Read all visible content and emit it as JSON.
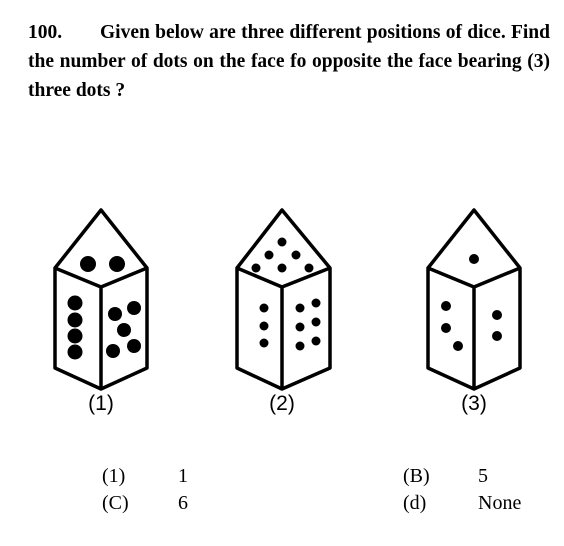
{
  "question": {
    "number": "100.",
    "text": "Given below are three different positions of dice. Find the number of  dots on the face fo opposite the face bearing  (3) three dots ?"
  },
  "dice": [
    {
      "label": "(1)",
      "top_face_dots": 2,
      "left_face_dots": 4,
      "right_face_dots": 5
    },
    {
      "label": "(2)",
      "top_face_dots": 6,
      "left_face_dots": 3,
      "right_face_dots": 6
    },
    {
      "label": "(3)",
      "top_face_dots": 1,
      "left_face_dots": 3,
      "right_face_dots": 2
    }
  ],
  "options": [
    {
      "key": "(1)",
      "value": "1"
    },
    {
      "key": "(B)",
      "value": "5"
    },
    {
      "key": "(C)",
      "value": "6"
    },
    {
      "key": "(d)",
      "value": "None"
    }
  ]
}
